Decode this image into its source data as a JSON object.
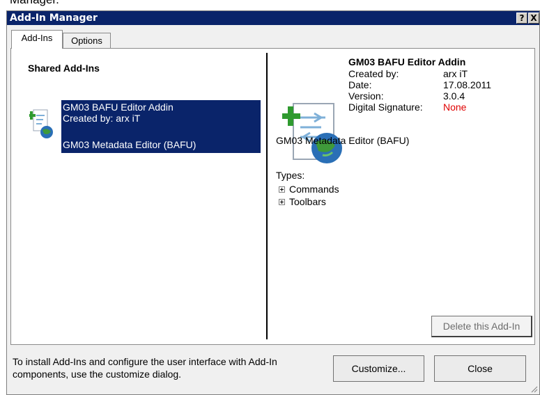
{
  "window": {
    "cut_heading": "Manager.",
    "title": "Add-In Manager",
    "help_button": "?",
    "close_button": "X"
  },
  "tabs": [
    {
      "label": "Add-Ins",
      "active": true
    },
    {
      "label": "Options",
      "active": false
    }
  ],
  "left_panel": {
    "heading": "Shared Add-Ins",
    "selected_item": {
      "name": "GM03 BAFU Editor Addin",
      "created_by": "Created by: arx iT",
      "description": "GM03 Metadata Editor (BAFU)",
      "icon": "addin-globe-icon"
    }
  },
  "details": {
    "title": "GM03 BAFU Editor Addin",
    "fields": [
      {
        "label": "Created by:",
        "value": "arx iT"
      },
      {
        "label": "Date:",
        "value": "17.08.2011"
      },
      {
        "label": "Version:",
        "value": "3.0.4"
      },
      {
        "label": "Digital Signature:",
        "value": "None"
      }
    ],
    "description": "GM03 Metadata Editor (BAFU)",
    "types_label": "Types:",
    "types": [
      "Commands",
      "Toolbars"
    ],
    "delete_button": "Delete this Add-In"
  },
  "footer": {
    "help_text": "To install Add-Ins and configure the user interface with Add-In components, use the customize dialog.",
    "customize_button": "Customize...",
    "close_button": "Close"
  },
  "colors": {
    "titlebar": "#0a246a",
    "selection": "#0a246a",
    "signature_none": "#e00000"
  }
}
